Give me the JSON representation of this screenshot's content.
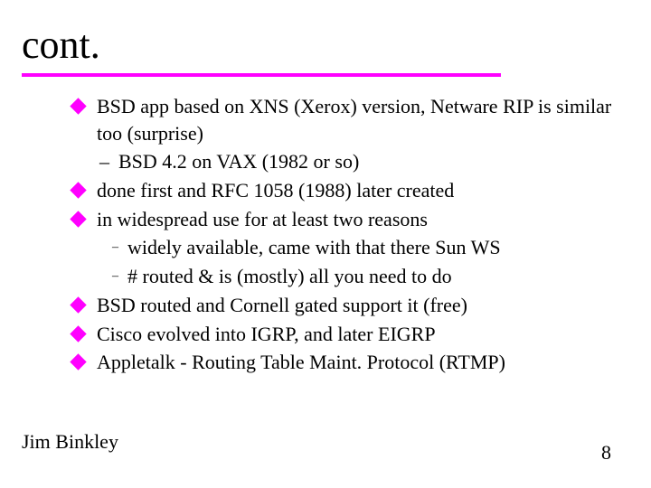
{
  "slide": {
    "title": "cont.",
    "bullets": [
      {
        "text": "BSD app based on XNS (Xerox) version,  Netware RIP is similar too (surprise)",
        "sub_en": [
          "BSD 4.2 on VAX (1982 or so)"
        ]
      },
      {
        "text": "done first and RFC 1058 (1988) later created"
      },
      {
        "text": "in widespread use for at least two reasons",
        "sub_sm": [
          "widely available, came with that there Sun WS",
          "# routed &  is (mostly) all you need to do"
        ]
      },
      {
        "text": "BSD routed and Cornell gated support it (free)"
      },
      {
        "text": "Cisco evolved into IGRP, and later EIGRP"
      },
      {
        "text": "Appletalk - Routing Table Maint. Protocol (RTMP)"
      }
    ],
    "footer_left": "Jim Binkley",
    "footer_right": "8"
  }
}
